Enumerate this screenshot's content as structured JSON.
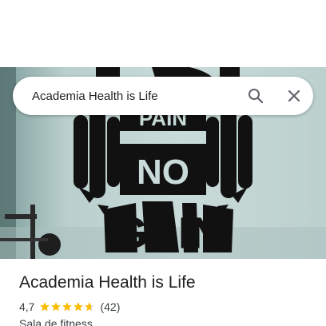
{
  "search": {
    "query": "Academia Health is Life",
    "search_icon": "search-icon",
    "close_icon": "close-icon"
  },
  "hero": {
    "image": "gym-wall-decal",
    "decal_text_top": "PAIN",
    "decal_text_mid": "NO",
    "decal_text_bottom": "GAIN"
  },
  "place": {
    "title": "Academia Health is Life",
    "rating": "4,7",
    "rating_stars": 4.7,
    "review_count": "(42)",
    "category": "Sala de fitness"
  },
  "colors": {
    "star": "#fbbc04",
    "text_primary": "#202124",
    "text_secondary": "#3c4043",
    "icon": "#5f6368"
  }
}
